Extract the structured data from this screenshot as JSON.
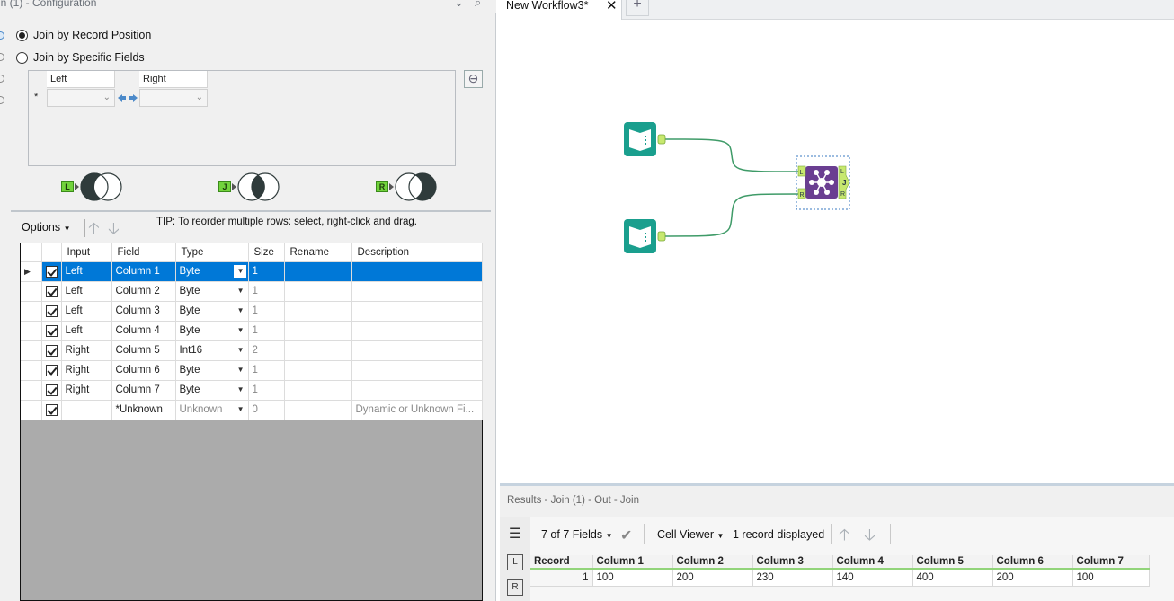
{
  "config_panel": {
    "title": "in (1) - Configuration",
    "join_by_position_label": "Join by Record Position",
    "join_by_fields_label": "Join by Specific Fields",
    "join_mode_selected": "Join by Record Position",
    "fields_header_left": "Left",
    "fields_header_right": "Right",
    "fields_row_marker": "*",
    "venn_tags": [
      "L",
      "J",
      "R"
    ],
    "options_label": "Options",
    "tip_text": "TIP: To reorder multiple rows: select, right-click and drag.",
    "grid_columns": [
      "Input",
      "Field",
      "Type",
      "Size",
      "Rename",
      "Description"
    ],
    "grid_rows": [
      {
        "input": "Left",
        "field": "Column 1",
        "type": "Byte",
        "size": "1",
        "rename": "",
        "description": "",
        "checked": true,
        "selected": true
      },
      {
        "input": "Left",
        "field": "Column 2",
        "type": "Byte",
        "size": "1",
        "rename": "",
        "description": "",
        "checked": true
      },
      {
        "input": "Left",
        "field": "Column 3",
        "type": "Byte",
        "size": "1",
        "rename": "",
        "description": "",
        "checked": true
      },
      {
        "input": "Left",
        "field": "Column 4",
        "type": "Byte",
        "size": "1",
        "rename": "",
        "description": "",
        "checked": true
      },
      {
        "input": "Right",
        "field": "Column 5",
        "type": "Int16",
        "size": "2",
        "rename": "",
        "description": "",
        "checked": true
      },
      {
        "input": "Right",
        "field": "Column 6",
        "type": "Byte",
        "size": "1",
        "rename": "",
        "description": "",
        "checked": true
      },
      {
        "input": "Right",
        "field": "Column 7",
        "type": "Byte",
        "size": "1",
        "rename": "",
        "description": "",
        "checked": true
      },
      {
        "input": "",
        "field": "*Unknown",
        "type": "Unknown",
        "size": "0",
        "rename": "",
        "description": "Dynamic or Unknown Fi...",
        "checked": true
      }
    ]
  },
  "workflow": {
    "tab_title": "New Workflow3*",
    "join_tool_ports_in": [
      "L",
      "R"
    ],
    "join_tool_ports_out": [
      "L",
      "J",
      "R"
    ],
    "accent_colors": {
      "input_tool": "#1a9f8e",
      "join_tool": "#6a3e91",
      "connector": "#3f9b68"
    }
  },
  "results": {
    "title": "Results - Join (1) - Out - Join",
    "fields_label": "7 of 7 Fields",
    "viewer_label": "Cell Viewer",
    "records_label": "1 record displayed",
    "side_icons": [
      "L",
      "R"
    ],
    "columns": [
      "Record",
      "Column 1",
      "Column 2",
      "Column 3",
      "Column 4",
      "Column 5",
      "Column 6",
      "Column 7"
    ],
    "rows": [
      [
        "1",
        "100",
        "200",
        "230",
        "140",
        "400",
        "200",
        "100"
      ]
    ]
  }
}
